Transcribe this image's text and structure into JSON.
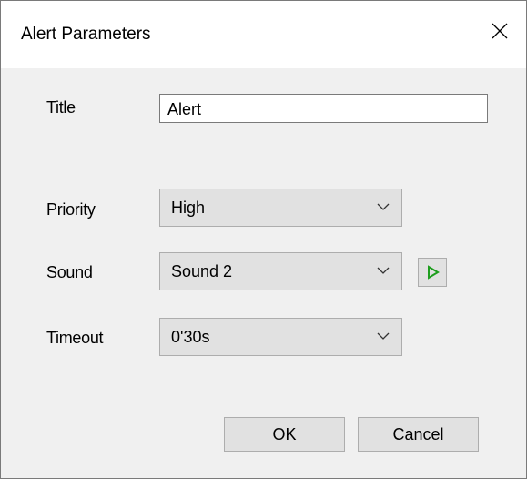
{
  "dialog": {
    "title": "Alert Parameters",
    "close_icon": "close-icon"
  },
  "fields": {
    "title": {
      "label": "Title",
      "value": "Alert"
    },
    "priority": {
      "label": "Priority",
      "selected": "High"
    },
    "sound": {
      "label": "Sound",
      "selected": "Sound 2",
      "play_icon": "play-icon",
      "play_color": "#1e9e1e"
    },
    "timeout": {
      "label": "Timeout",
      "selected": "0'30s"
    }
  },
  "buttons": {
    "ok": "OK",
    "cancel": "Cancel"
  }
}
